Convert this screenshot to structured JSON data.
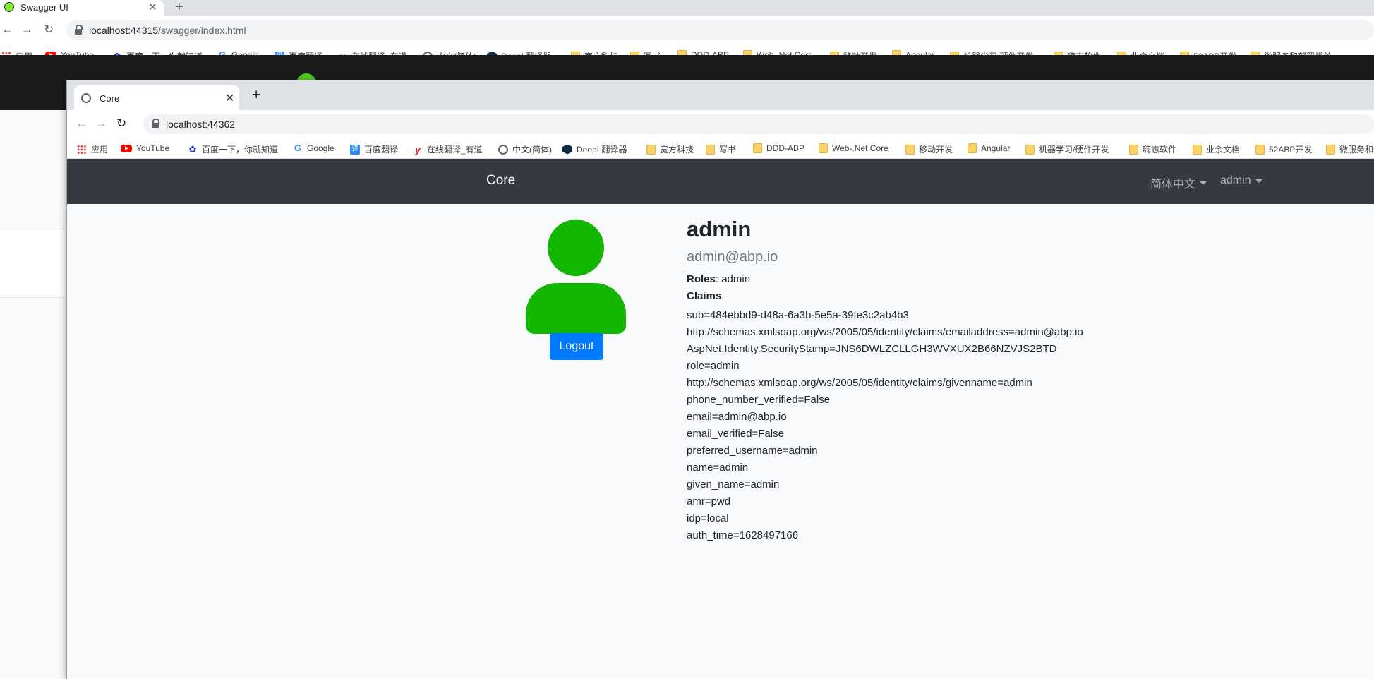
{
  "outer_browser": {
    "tab_title": "Swagger UI",
    "url_host": "localhost:44315",
    "url_path": "/swagger/index.html"
  },
  "inner_browser": {
    "tab_title": "Core",
    "url_host": "localhost:44362",
    "url_path": ""
  },
  "bookmarks": [
    {
      "label": "应用",
      "icon": "apps-icon"
    },
    {
      "label": "YouTube",
      "icon": "youtube-icon"
    },
    {
      "label": "百度一下，你就知道",
      "icon": "baidu-icon"
    },
    {
      "label": "Google",
      "icon": "google-icon"
    },
    {
      "label": "百度翻译",
      "icon": "fanyi-icon"
    },
    {
      "label": "在线翻译_有道",
      "icon": "youdao-icon"
    },
    {
      "label": "中文(简体)",
      "icon": "globe-icon"
    },
    {
      "label": "DeepL翻译器",
      "icon": "deepl-icon"
    },
    {
      "label": "宽方科技",
      "icon": "folder-icon"
    },
    {
      "label": "写书",
      "icon": "folder-icon"
    },
    {
      "label": "DDD-ABP",
      "icon": "folder-icon"
    },
    {
      "label": "Web-.Net Core",
      "icon": "folder-icon"
    },
    {
      "label": "移动开发",
      "icon": "folder-icon"
    },
    {
      "label": "Angular",
      "icon": "folder-icon"
    },
    {
      "label": "机器学习/硬件开发",
      "icon": "folder-icon"
    },
    {
      "label": "嗨志软件",
      "icon": "folder-icon"
    },
    {
      "label": "业余文档",
      "icon": "folder-icon"
    },
    {
      "label": "52ABP开发",
      "icon": "folder-icon"
    },
    {
      "label": "微服务和部署相关...",
      "icon": "folder-icon"
    }
  ],
  "navbar": {
    "brand": "Core",
    "language": "简体中文",
    "user": "admin"
  },
  "profile": {
    "name": "admin",
    "email": "admin@abp.io",
    "roles_label": "Roles",
    "roles_value": ": admin",
    "claims_label": "Claims",
    "claims_suffix": ":",
    "claims": [
      "sub=484ebbd9-d48a-6a3b-5e5a-39fe3c2ab4b3",
      "http://schemas.xmlsoap.org/ws/2005/05/identity/claims/emailaddress=admin@abp.io",
      "AspNet.Identity.SecurityStamp=JNS6DWLZCLLGH3WVXUX2B66NZVJS2BTD",
      "role=admin",
      "http://schemas.xmlsoap.org/ws/2005/05/identity/claims/givenname=admin",
      "phone_number_verified=False",
      "email=admin@abp.io",
      "email_verified=False",
      "preferred_username=admin",
      "name=admin",
      "given_name=admin",
      "amr=pwd",
      "idp=local",
      "auth_time=1628497166"
    ],
    "logout_label": "Logout"
  },
  "colors": {
    "navbar_bg": "#343a40",
    "avatar": "#13b702",
    "primary_button": "#007bff"
  }
}
